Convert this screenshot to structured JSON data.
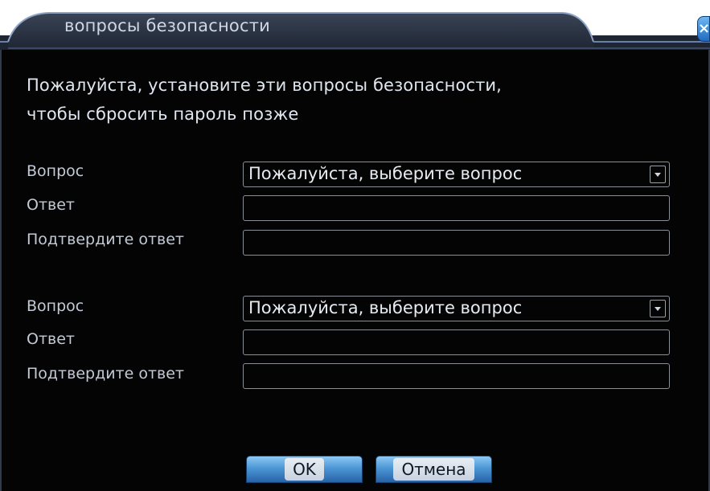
{
  "window": {
    "title": "вопросы безопасности",
    "close_glyph": "×"
  },
  "instruction": "Пожалуйста, установите эти вопросы безопасности,\nчтобы сбросить пароль позже",
  "question_groups": [
    {
      "question_label": "Вопрос",
      "question_value": "Пожалуйста, выберите вопрос",
      "answer_label": "Ответ",
      "answer_value": "",
      "confirm_label": "Подтвердите ответ",
      "confirm_value": ""
    },
    {
      "question_label": "Вопрос",
      "question_value": "Пожалуйста, выберите вопрос",
      "answer_label": "Ответ",
      "answer_value": "",
      "confirm_label": "Подтвердите ответ",
      "confirm_value": ""
    }
  ],
  "buttons": {
    "ok_label": "OK",
    "cancel_label": "Отмена"
  },
  "colors": {
    "background": "#040404",
    "text": "#dfe6ef",
    "accent_blue": "#4d97d6",
    "field_border": "#8b8f97"
  },
  "icons": {
    "close": "close-icon",
    "dropdown": "chevron-down-icon"
  }
}
